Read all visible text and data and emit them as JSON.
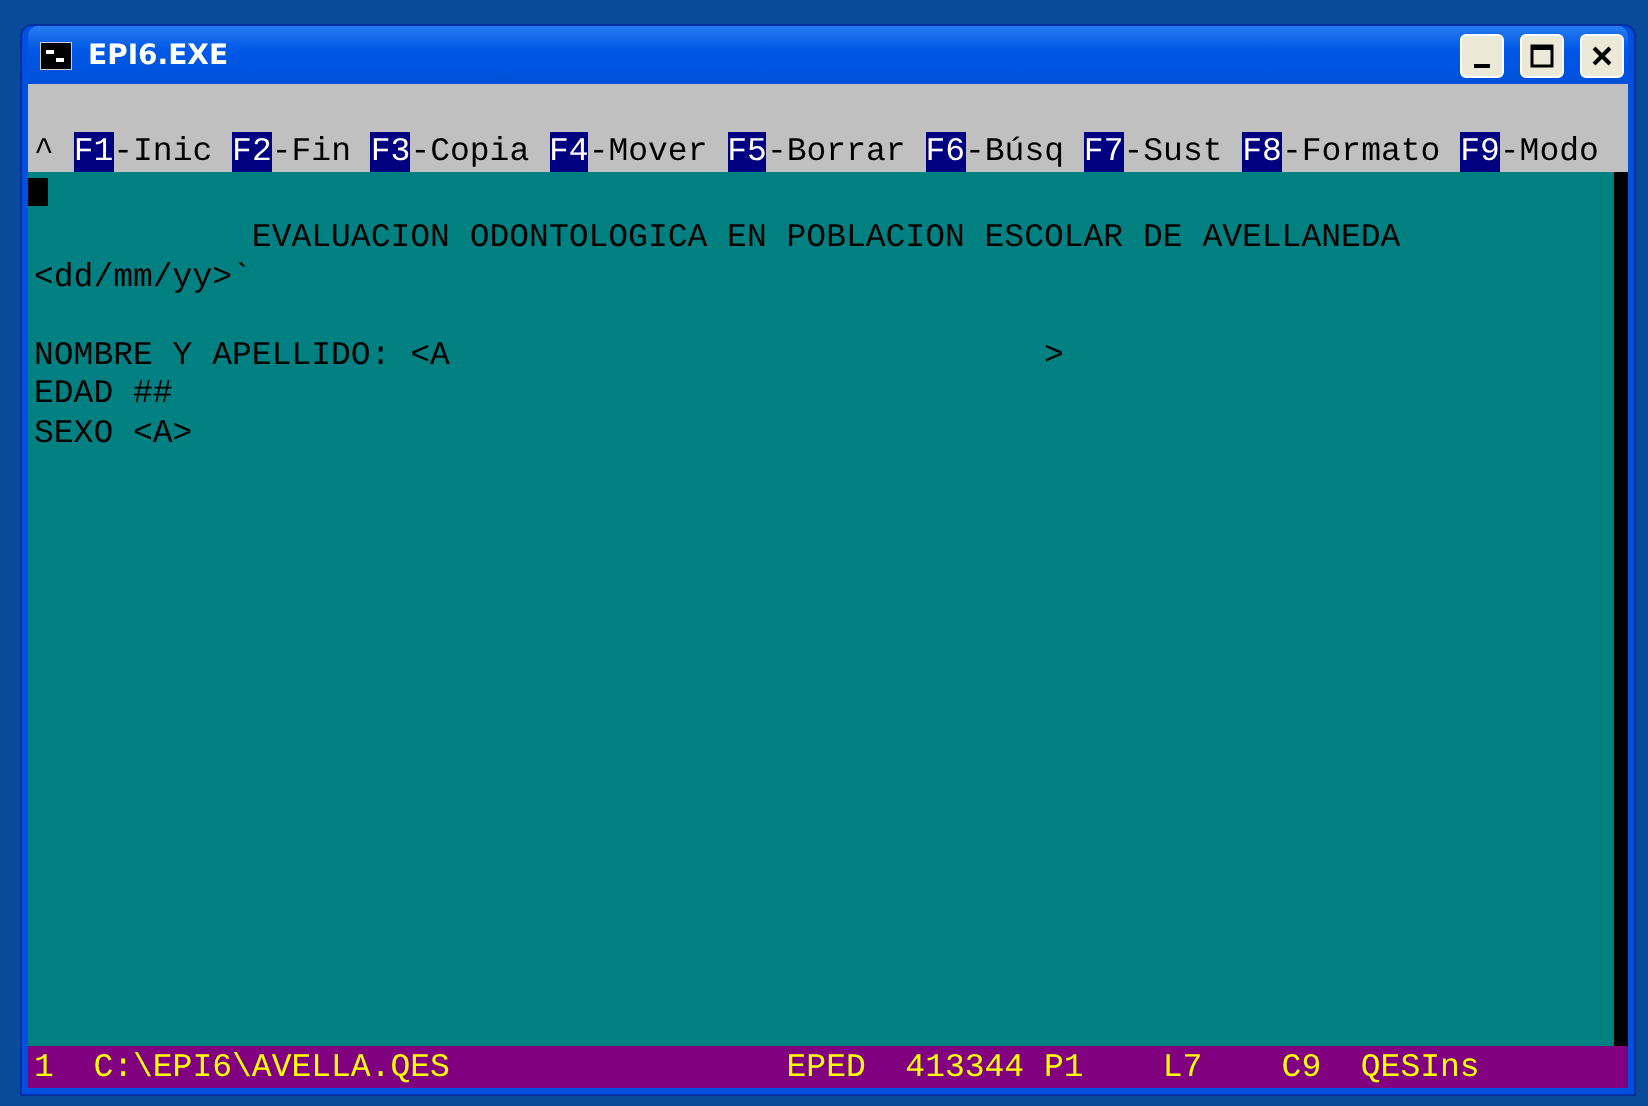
{
  "window": {
    "title": "EPI6.EXE"
  },
  "menu": {
    "prefix": "^",
    "items": [
      {
        "key": "F1",
        "label": "-Inic"
      },
      {
        "key": "F2",
        "label": "-Fin"
      },
      {
        "key": "F3",
        "label": "-Copia"
      },
      {
        "key": "F4",
        "label": "-Mover"
      },
      {
        "key": "F5",
        "label": "-Borrar"
      },
      {
        "key": "F6",
        "label": "-Búsq"
      },
      {
        "key": "F7",
        "label": "-Sust"
      },
      {
        "key": "F8",
        "label": "-Formato"
      },
      {
        "key": "F9",
        "label": "-Modo"
      }
    ]
  },
  "header_lines": [
    "           EVALUACION ODONTOLOGICA EN POBLACION ESCOLAR DE AVELLANEDA",
    "<dd/mm/yy>`"
  ],
  "field_lines": [
    "NOMBRE Y APELLIDO: <A                              >",
    "EDAD ##",
    "SEXO <A>"
  ],
  "status_bar": "1  C:\\EPI6\\AVELLA.QES                 EPED  413344 P1    L7    C9  QESIns"
}
